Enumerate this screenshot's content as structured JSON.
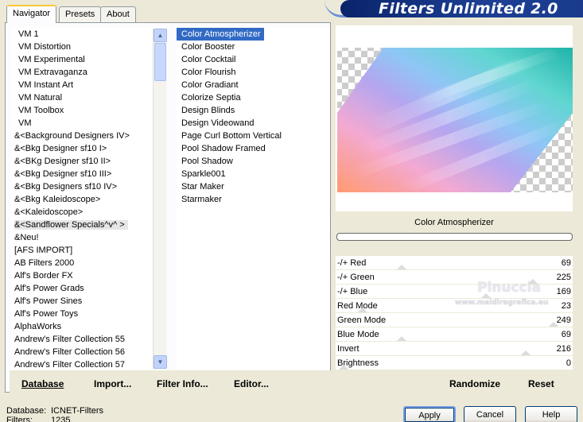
{
  "title": "Filters Unlimited 2.0",
  "tabs": [
    {
      "label": "Navigator",
      "active": true
    },
    {
      "label": "Presets",
      "active": false
    },
    {
      "label": "About",
      "active": false
    }
  ],
  "categories": [
    "VM 1",
    "VM Distortion",
    "VM Experimental",
    "VM Extravaganza",
    "VM Instant Art",
    "VM Natural",
    "VM Toolbox",
    "VM",
    "&<Background Designers IV>",
    "&<Bkg Designer sf10 I>",
    "&<BKg Designer sf10 II>",
    "&<Bkg Designer sf10 III>",
    "&<Bkg Designers sf10 IV>",
    "&<Bkg Kaleidoscope>",
    "&<Kaleidoscope>",
    "&<Sandflower Specials^v^ >",
    "&Neu!",
    "[AFS IMPORT]",
    "AB Filters 2000",
    "Alf's Border FX",
    "Alf's Power Grads",
    "Alf's Power Sines",
    "Alf's Power Toys",
    "AlphaWorks",
    "Andrew's Filter Collection 55",
    "Andrew's Filter Collection 56",
    "Andrew's Filter Collection 57"
  ],
  "highlighted_category": "&<Sandflower Specials^v^ >",
  "filters": [
    "Color Atmospherizer",
    "Color Booster",
    "Color Cocktail",
    "Color Flourish",
    "Color Gradiant",
    "Colorize Septia",
    "Design Blinds",
    "Design Videowand",
    "Page Curl Bottom Vertical",
    "Pool Shadow Framed",
    "Pool Shadow",
    "Sparkle001",
    "Star Maker",
    "Starmaker"
  ],
  "selected_filter": "Color Atmospherizer",
  "left_buttons": {
    "database": "Database",
    "import": "Import...",
    "filter_info": "Filter Info...",
    "editor": "Editor..."
  },
  "preview_label": "Color Atmospherizer",
  "params": [
    {
      "name": "-/+ Red",
      "value": "69"
    },
    {
      "name": "-/+ Green",
      "value": "225"
    },
    {
      "name": "-/+ Blue",
      "value": "169"
    },
    {
      "name": "Red Mode",
      "value": "23"
    },
    {
      "name": "Green Mode",
      "value": "249"
    },
    {
      "name": "Blue Mode",
      "value": "69"
    },
    {
      "name": "Invert",
      "value": "216"
    },
    {
      "name": "Brightness",
      "value": "0"
    }
  ],
  "right_buttons": {
    "randomize": "Randomize",
    "reset": "Reset"
  },
  "watermark": {
    "line1": "Pinuccia",
    "line2": "www.maidiregrafica.eu"
  },
  "db_info": {
    "database_key": "Database:",
    "database_val": "ICNET-Filters",
    "filters_key": "Filters:",
    "filters_val": "1235"
  },
  "dialog_buttons": {
    "apply": "Apply",
    "cancel": "Cancel",
    "help": "Help"
  }
}
